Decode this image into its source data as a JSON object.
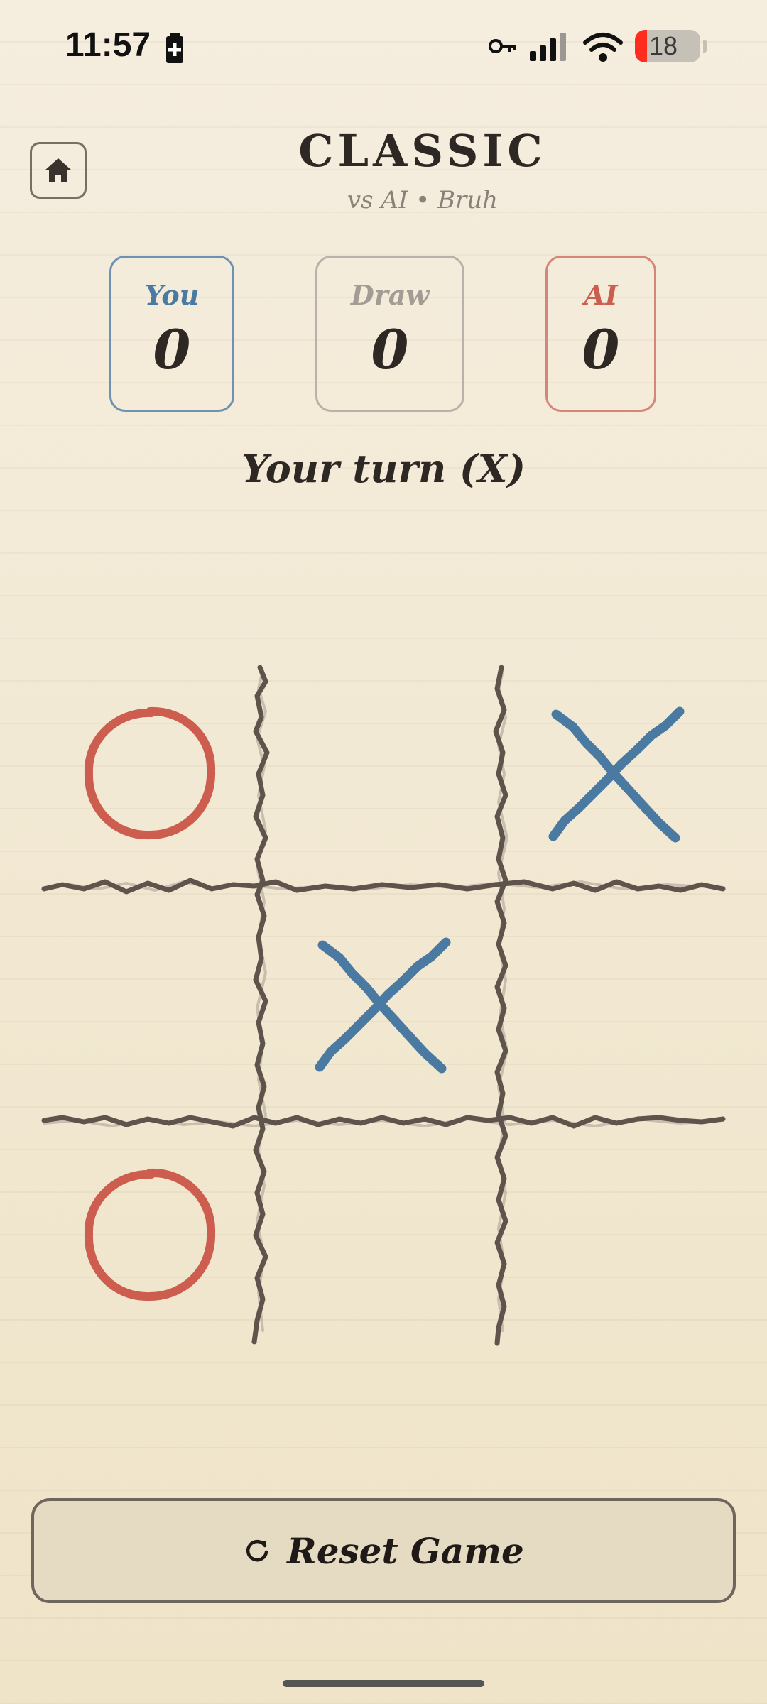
{
  "status_bar": {
    "time": "11:57",
    "battery_level": "18",
    "battery_fraction": 0.18,
    "icons": [
      "battery-saver-icon",
      "vpn-key-icon",
      "cell-signal-icon",
      "wifi-icon"
    ]
  },
  "header": {
    "home_icon": "home-icon",
    "title": "CLASSIC",
    "subtitle": "vs AI • Bruh"
  },
  "scoreboard": {
    "you": {
      "label": "You",
      "value": "0"
    },
    "draw": {
      "label": "Draw",
      "value": "0"
    },
    "ai": {
      "label": "AI",
      "value": "0"
    }
  },
  "turn_status": "Your turn (X)",
  "board": {
    "cells": [
      "O",
      "",
      "X",
      "",
      "X",
      "",
      "O",
      "",
      ""
    ]
  },
  "reset": {
    "icon": "refresh-icon",
    "label": "Reset Game"
  },
  "colors": {
    "x": "#4a7aa2",
    "o": "#cd5d4f",
    "grid": "#5e544b",
    "background": "#f3ead7"
  }
}
